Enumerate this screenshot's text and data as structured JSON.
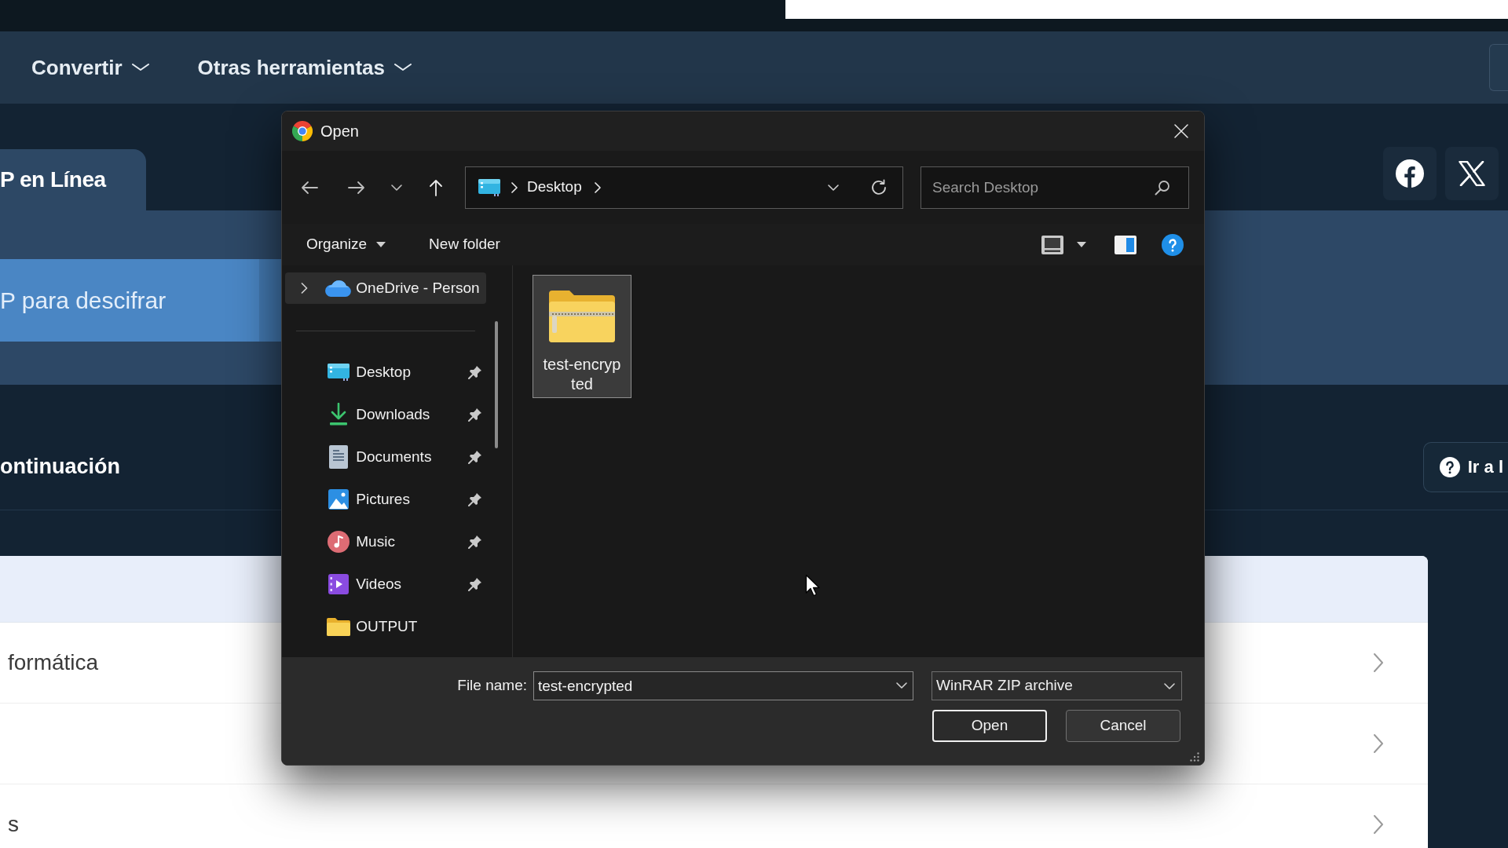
{
  "page": {
    "nav": [
      {
        "label": "Convertir"
      },
      {
        "label": "Otras herramientas"
      }
    ],
    "tab": {
      "label": "P en Línea"
    },
    "upload_button": {
      "label": "P para descifrar"
    },
    "section": {
      "heading": "ontinuación",
      "help_button": {
        "label": "Ir a l"
      }
    },
    "list": {
      "rows": [
        {
          "label": "formática"
        },
        {},
        {
          "label": "s"
        }
      ]
    }
  },
  "dialog": {
    "title": "Open",
    "address": {
      "crumbs": [
        "Desktop"
      ]
    },
    "search": {
      "placeholder": "Search Desktop"
    },
    "commands": [
      {
        "label": "Organize",
        "kind": "menu"
      },
      {
        "label": "New folder",
        "kind": "button"
      }
    ],
    "sidebar": {
      "top": [
        {
          "label": "OneDrive - Person",
          "selected": true,
          "expanded": false
        }
      ],
      "quick_access": [
        {
          "label": "Desktop",
          "selected": false,
          "pinned": true
        },
        {
          "label": "Downloads",
          "selected": false,
          "pinned": true
        },
        {
          "label": "Documents",
          "selected": false,
          "pinned": true
        },
        {
          "label": "Pictures",
          "selected": false,
          "pinned": true
        },
        {
          "label": "Music",
          "selected": false,
          "pinned": true
        },
        {
          "label": "Videos",
          "selected": false,
          "pinned": true
        },
        {
          "label": "OUTPUT",
          "selected": false,
          "pinned": false
        }
      ]
    },
    "files": [
      {
        "name": "test-encrypted",
        "selected": true
      }
    ],
    "file_name": {
      "label": "File name:",
      "value": "test-encrypted"
    },
    "file_type": {
      "value": "WinRAR ZIP archive"
    },
    "buttons": [
      {
        "label": "Open",
        "kind": "primary"
      },
      {
        "label": "Cancel",
        "kind": "secondary"
      }
    ]
  }
}
